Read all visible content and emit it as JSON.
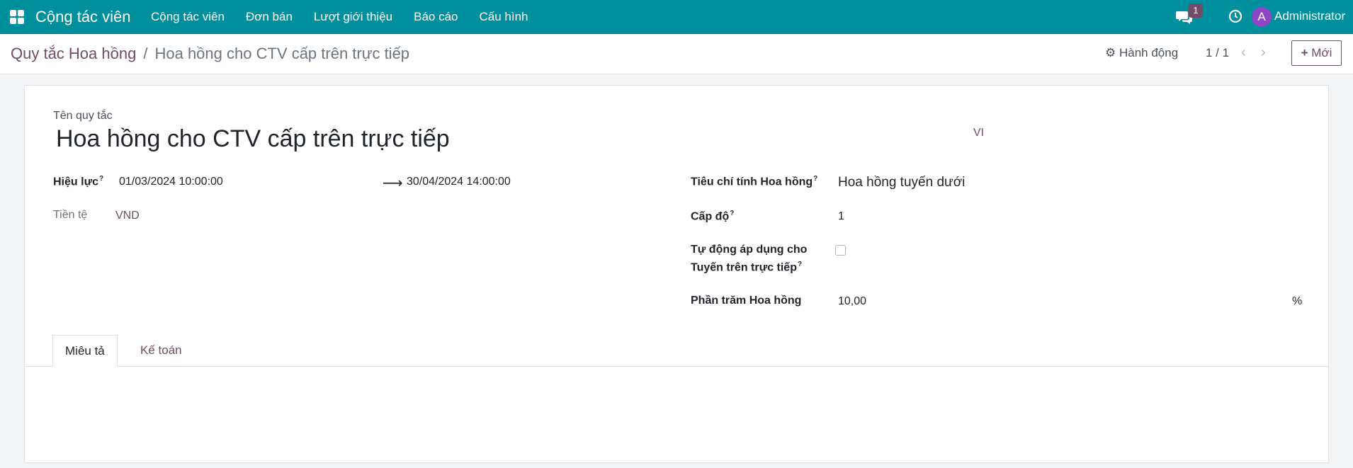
{
  "navbar": {
    "app_name": "Cộng tác viên",
    "menu": [
      "Cộng tác viên",
      "Đơn bán",
      "Lượt giới thiệu",
      "Báo cáo",
      "Cấu hình"
    ],
    "chat_count": "1",
    "avatar_letter": "A",
    "user_name": "Administrator",
    "bg_color": "#00909d"
  },
  "control_panel": {
    "breadcrumb_parent": "Quy tắc Hoa hồng",
    "breadcrumb_sep": "/",
    "breadcrumb_current": "Hoa hồng cho CTV cấp trên trực tiếp",
    "action_label": "Hành động",
    "pager": "1 / 1",
    "new_label": "Mới"
  },
  "form": {
    "name_label": "Tên quy tắc",
    "name_value": "Hoa hồng cho CTV cấp trên trực tiếp",
    "lang": "VI",
    "validity_label": "Hiệu lực",
    "date_from": "01/03/2024 10:00:00",
    "date_to": "30/04/2024 14:00:00",
    "currency_label": "Tiền tệ",
    "currency_value": "VND",
    "criteria_label": "Tiêu chí tính Hoa hồng",
    "criteria_value": "Hoa hồng tuyến dưới",
    "level_label": "Cấp độ",
    "level_value": "1",
    "auto_apply_label_1": "Tự động áp dụng cho",
    "auto_apply_label_2": "Tuyến trên trực tiếp",
    "auto_apply_checked": false,
    "percent_label": "Phần trăm Hoa hồng",
    "percent_value": "10,00",
    "percent_unit": "%",
    "help_mark": "?"
  },
  "tabs": [
    "Miêu tả",
    "Kế toán"
  ],
  "accent_color": "#714b67"
}
